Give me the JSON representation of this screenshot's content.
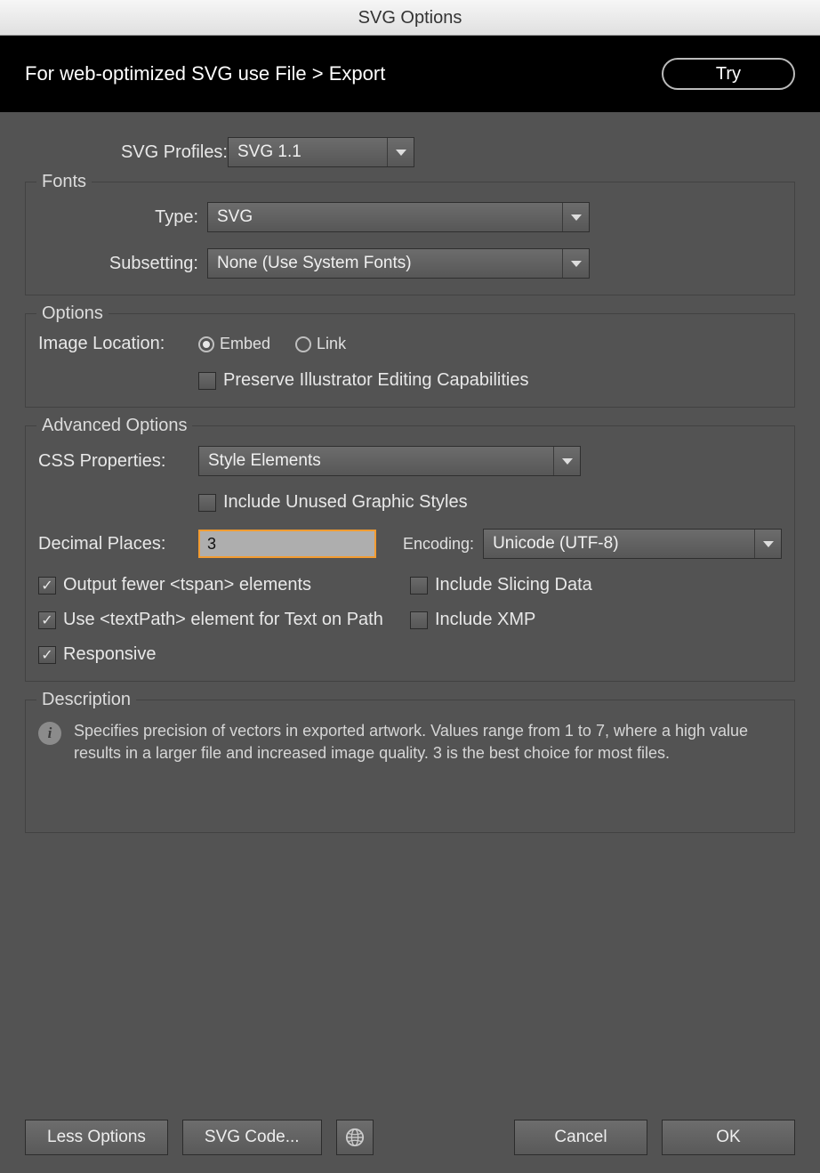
{
  "window": {
    "title": "SVG Options"
  },
  "promo": {
    "text": "For web-optimized SVG use File > Export",
    "try_label": "Try"
  },
  "profiles": {
    "label": "SVG Profiles:",
    "value": "SVG 1.1"
  },
  "fonts": {
    "legend": "Fonts",
    "type_label": "Type:",
    "type_value": "SVG",
    "subsetting_label": "Subsetting:",
    "subsetting_value": "None (Use System Fonts)"
  },
  "options": {
    "legend": "Options",
    "image_location_label": "Image Location:",
    "embed_label": "Embed",
    "link_label": "Link",
    "embed_selected": true,
    "preserve_label": "Preserve Illustrator Editing Capabilities",
    "preserve_checked": false
  },
  "advanced": {
    "legend": "Advanced Options",
    "css_label": "CSS Properties:",
    "css_value": "Style Elements",
    "include_unused_label": "Include Unused Graphic Styles",
    "include_unused_checked": false,
    "decimal_label": "Decimal Places:",
    "decimal_value": "3",
    "encoding_label": "Encoding:",
    "encoding_value": "Unicode (UTF-8)",
    "output_tspan_label": "Output fewer <tspan> elements",
    "output_tspan_checked": true,
    "slicing_label": "Include Slicing Data",
    "slicing_checked": false,
    "textpath_label": "Use <textPath> element for Text on Path",
    "textpath_checked": true,
    "xmp_label": "Include XMP",
    "xmp_checked": false,
    "responsive_label": "Responsive",
    "responsive_checked": true
  },
  "description": {
    "legend": "Description",
    "text": "Specifies precision of vectors in exported artwork. Values range from 1 to 7, where a high value results in a larger file and increased image quality. 3 is the best choice for most files."
  },
  "buttons": {
    "less_options": "Less Options",
    "svg_code": "SVG Code...",
    "cancel": "Cancel",
    "ok": "OK"
  }
}
